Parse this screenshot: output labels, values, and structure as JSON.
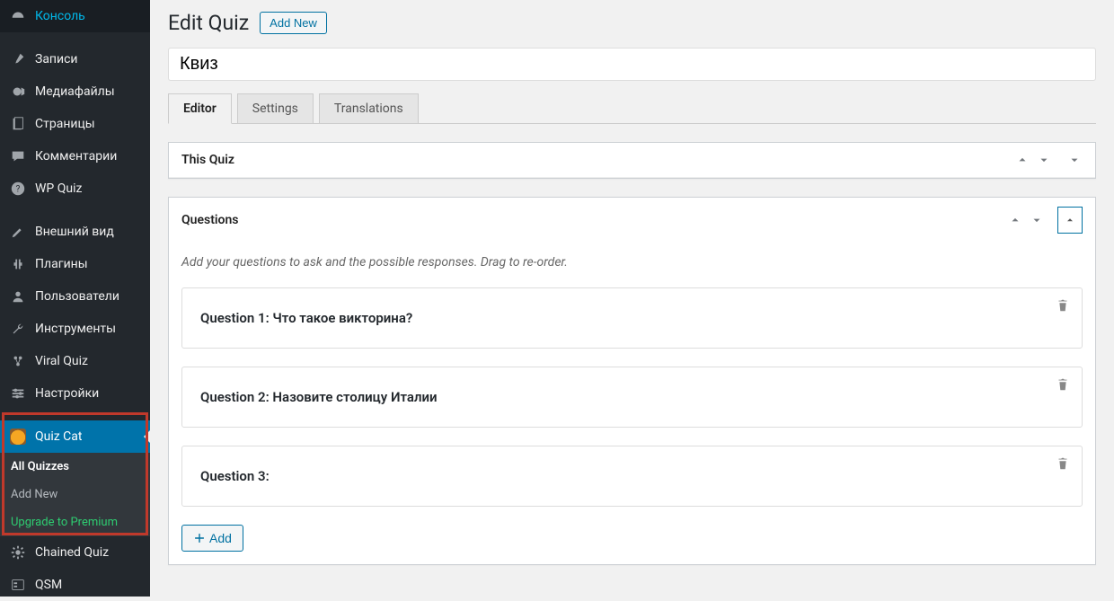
{
  "sidebar": {
    "items": [
      {
        "icon": "dashboard",
        "label": "Консоль"
      },
      {
        "icon": "pin",
        "label": "Записи"
      },
      {
        "icon": "media",
        "label": "Медиафайлы"
      },
      {
        "icon": "page",
        "label": "Страницы"
      },
      {
        "icon": "comment",
        "label": "Комментарии"
      },
      {
        "icon": "help",
        "label": "WP Quiz"
      },
      {
        "icon": "brush",
        "label": "Внешний вид"
      },
      {
        "icon": "plugin",
        "label": "Плагины"
      },
      {
        "icon": "user",
        "label": "Пользователи"
      },
      {
        "icon": "tools",
        "label": "Инструменты"
      },
      {
        "icon": "viral",
        "label": "Viral Quiz"
      },
      {
        "icon": "settings",
        "label": "Настройки"
      },
      {
        "icon": "quizcat",
        "label": "Quiz Cat",
        "active": true
      },
      {
        "icon": "gear",
        "label": "Chained Quiz"
      },
      {
        "icon": "qsm",
        "label": "QSM"
      }
    ],
    "submenu": {
      "all": "All Quizzes",
      "addnew": "Add New",
      "upgrade": "Upgrade to Premium"
    }
  },
  "header": {
    "title": "Edit Quiz",
    "addnew": "Add New"
  },
  "quiz_title": "Квиз",
  "tabs": {
    "editor": "Editor",
    "settings": "Settings",
    "translations": "Translations"
  },
  "thisquiz": {
    "title": "This Quiz"
  },
  "questions": {
    "title": "Questions",
    "hint": "Add your questions to ask and the possible responses. Drag to re-order.",
    "q1": "Question 1: Что такое викторина?",
    "q2": "Question 2: Назовите столицу Италии",
    "q3": "Question 3:",
    "add": "Add"
  }
}
